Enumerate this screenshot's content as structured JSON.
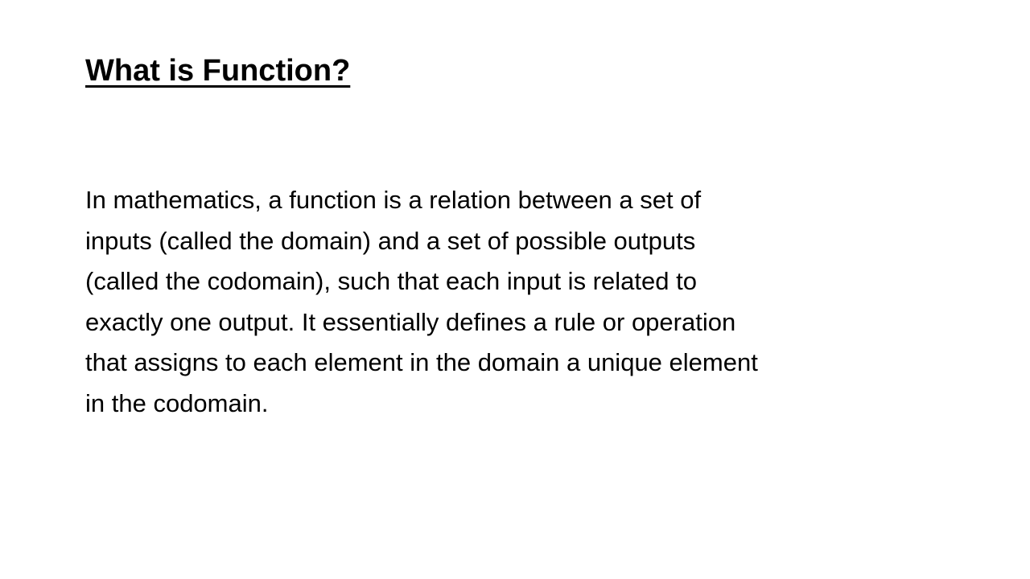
{
  "slide": {
    "title": "What is Function?",
    "body_lines": [
      "In mathematics, a function is a relation between a set of",
      "inputs (called the domain) and a set of possible outputs",
      "(called the codomain), such that each input is related to",
      "exactly one output. It essentially defines a rule or operation",
      "that assigns to each element in the domain a unique element",
      "in the codomain."
    ]
  }
}
